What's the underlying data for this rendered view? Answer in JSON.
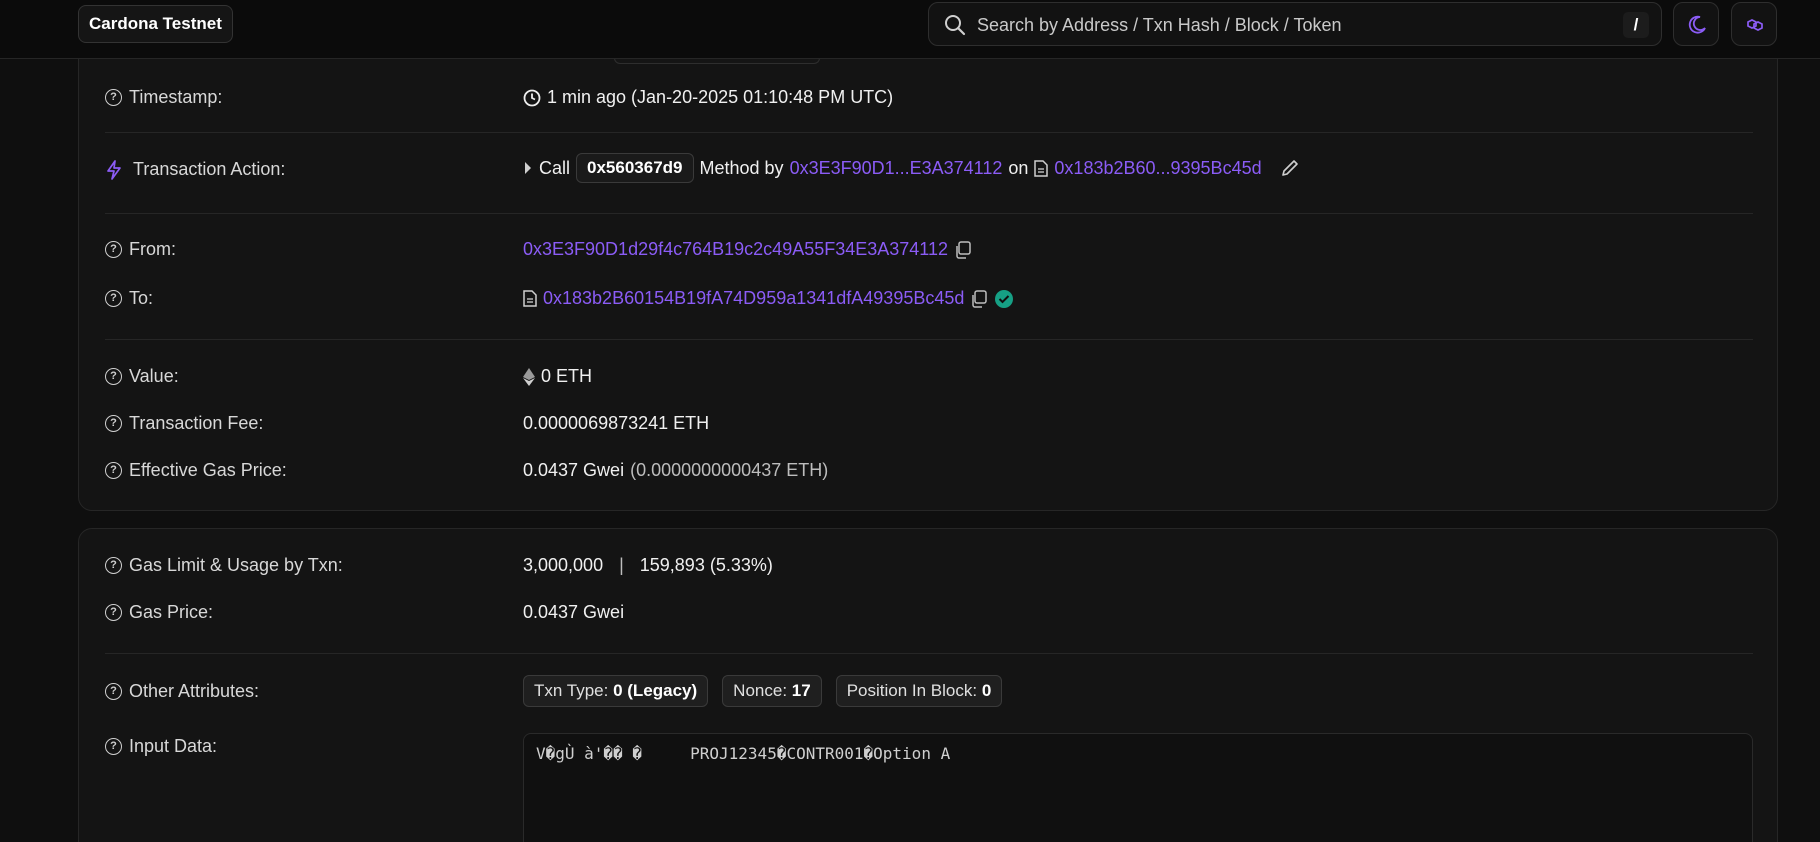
{
  "topbar": {
    "network": "Cardona Testnet",
    "search_placeholder": "Search by Address / Txn Hash / Block / Token",
    "search_shortcut": "/",
    "accent": "#8b5cf6"
  },
  "details": {
    "timestamp": {
      "label": "Timestamp:",
      "value": "1 min ago (Jan-20-2025 01:10:48 PM UTC)"
    },
    "action": {
      "label": "Transaction Action:",
      "call": "Call",
      "method": "0x560367d9",
      "method_by": "Method by",
      "by_address": "0x3E3F90D1...E3A374112",
      "on": "on",
      "contract": "0x183b2B60...9395Bc45d"
    },
    "from": {
      "label": "From:",
      "value": "0x3E3F90D1d29f4c764B19c2c49A55F34E3A374112"
    },
    "to": {
      "label": "To:",
      "value": "0x183b2B60154B19fA74D959a1341dfA49395Bc45d"
    },
    "value": {
      "label": "Value:",
      "value": "0 ETH"
    },
    "fee": {
      "label": "Transaction Fee:",
      "value": "0.0000069873241 ETH"
    },
    "effective_gas": {
      "label": "Effective Gas Price:",
      "gwei": "0.0437 Gwei",
      "eth": "(0.0000000000437 ETH)"
    }
  },
  "gas": {
    "limit": {
      "label": "Gas Limit & Usage by Txn:",
      "limit_value": "3,000,000",
      "separator": "|",
      "usage": "159,893 (5.33%)"
    },
    "price": {
      "label": "Gas Price:",
      "value": "0.0437 Gwei"
    },
    "other": {
      "label": "Other Attributes:",
      "txn_type_label": "Txn Type:",
      "txn_type_value": "0 (Legacy)",
      "nonce_label": "Nonce:",
      "nonce_value": "17",
      "position_label": "Position In Block:",
      "position_value": "0"
    },
    "input": {
      "label": "Input Data:",
      "value": "V�gÙ à'�� �     PROJ12345�CONTR001�Option A"
    }
  }
}
